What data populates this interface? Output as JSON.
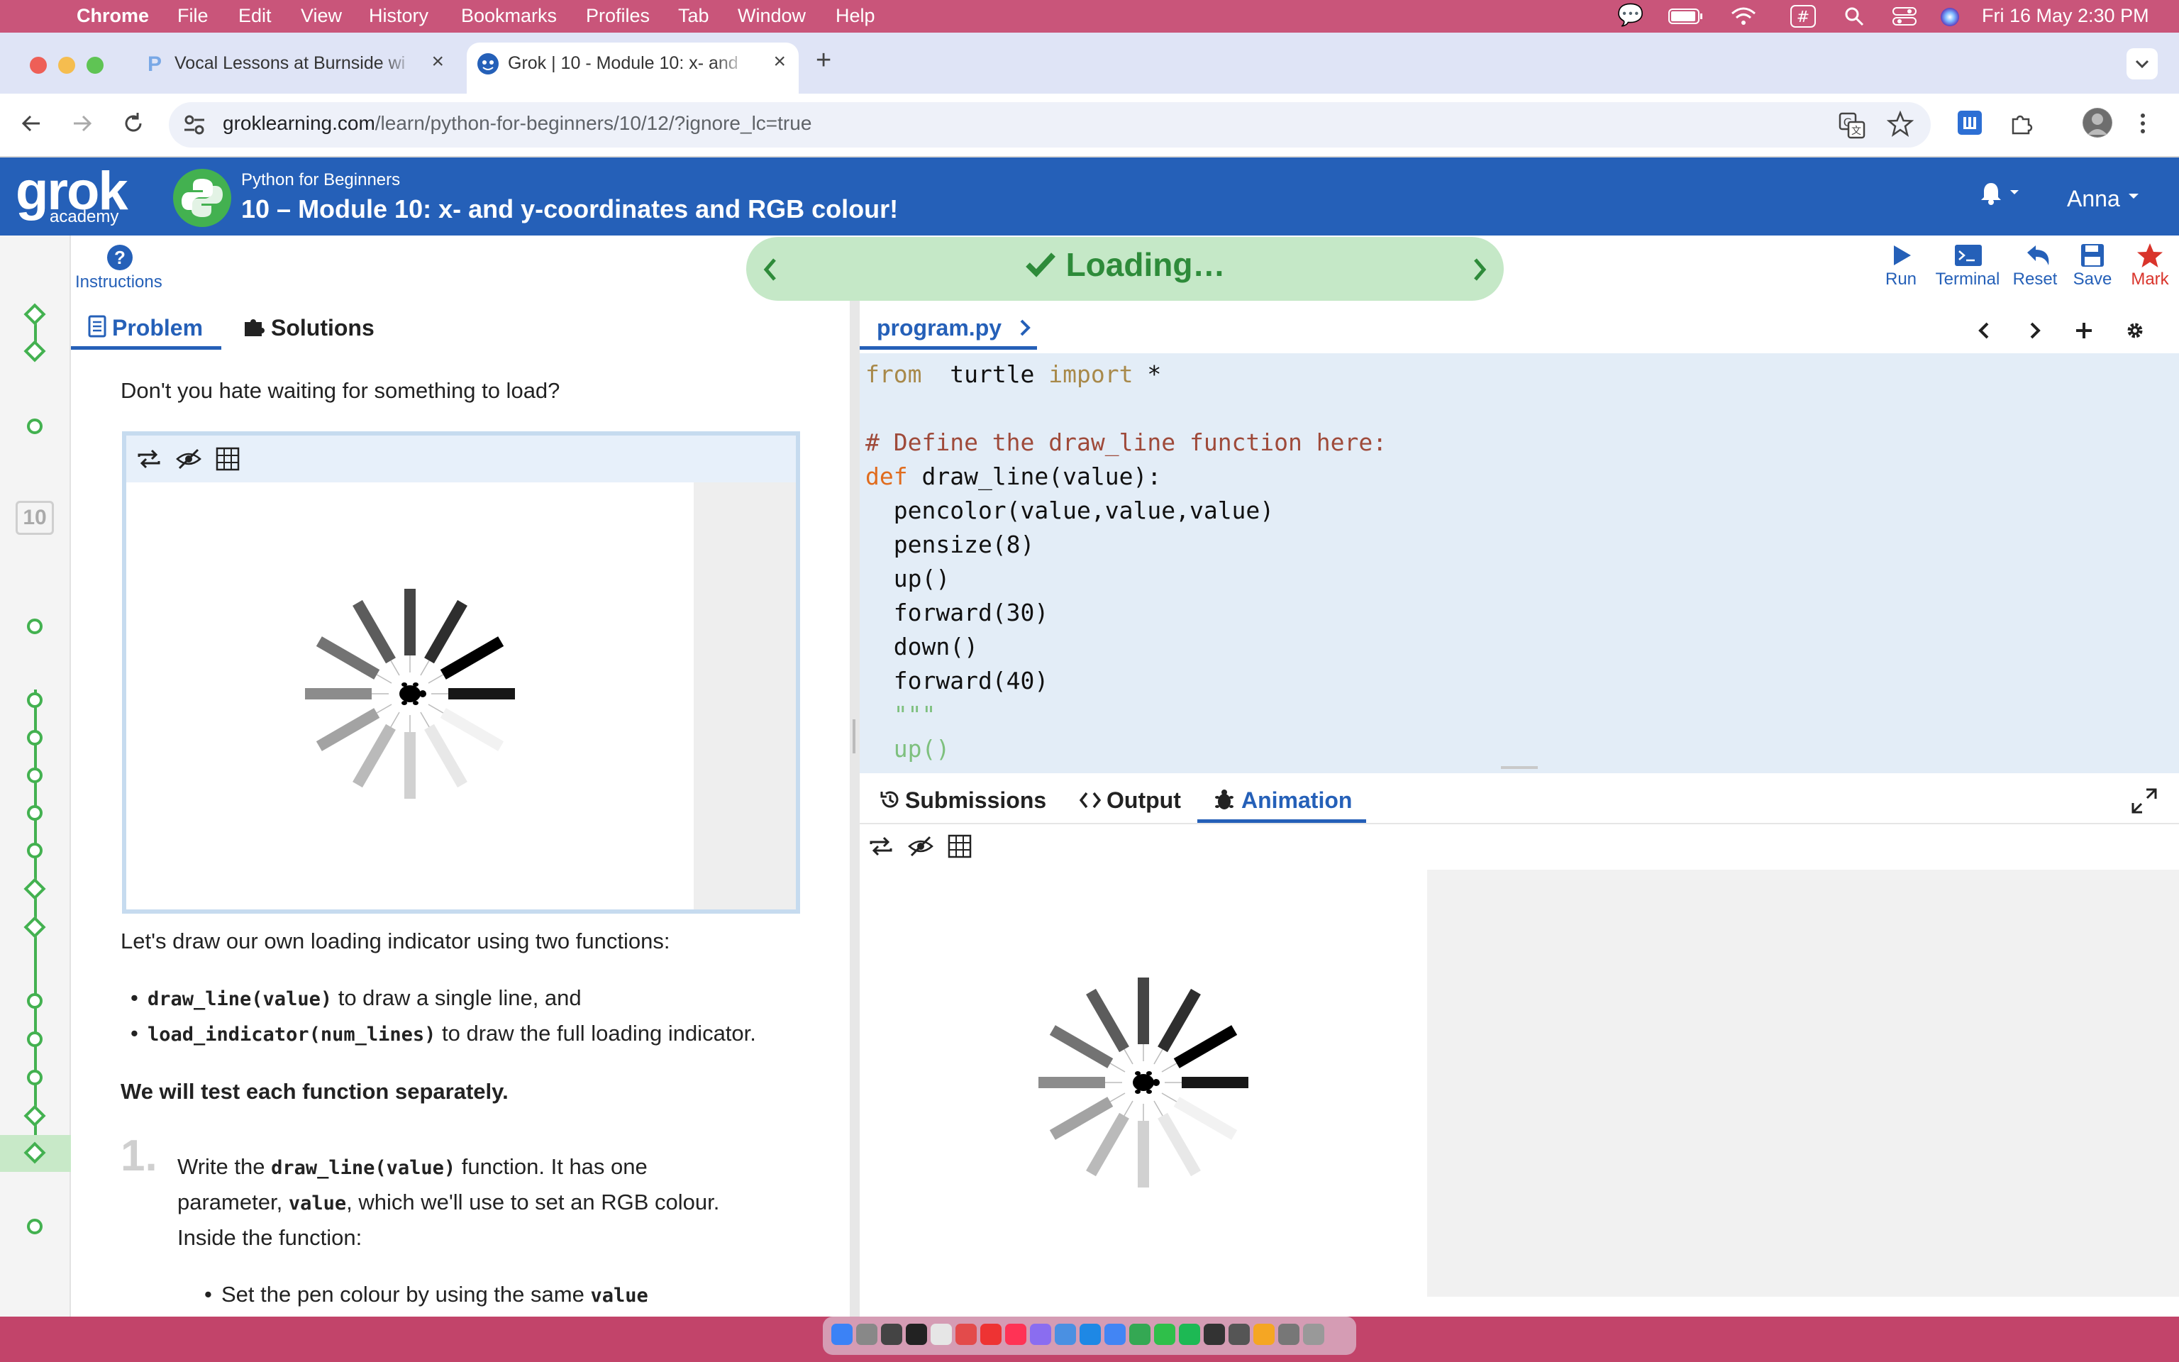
{
  "menubar": {
    "app": "Chrome",
    "items": [
      "File",
      "Edit",
      "View",
      "History",
      "Bookmarks",
      "Profiles",
      "Tab",
      "Window",
      "Help"
    ],
    "clock": "Fri 16 May  2:30 PM"
  },
  "tabs": [
    {
      "title": "Vocal Lessons at Burnside wi",
      "active": false
    },
    {
      "title": "Grok | 10 - Module 10: x- and",
      "active": true
    }
  ],
  "address": {
    "host": "groklearning.com",
    "path": "/learn/python-for-beginners/10/12/?ignore_lc=true"
  },
  "grok": {
    "logo": "grok",
    "logo_sub": "academy",
    "course": "Python for Beginners",
    "module_title": "10 – Module 10: x- and y-coordinates and RGB colour!",
    "user": "Anna"
  },
  "nav": {
    "instructions": "Instructions",
    "banner": "Loading…",
    "tools": [
      "Run",
      "Terminal",
      "Reset",
      "Save",
      "Mark"
    ]
  },
  "rail": {
    "module_number": "10"
  },
  "problem": {
    "tabs": [
      "Problem",
      "Solutions"
    ],
    "intro": "Don't you hate waiting for something to load?",
    "lead": "Let's draw our own loading indicator using two functions:",
    "bullets": [
      {
        "code": "draw_line(value)",
        "text": " to draw a single line, and"
      },
      {
        "code": "load_indicator(num_lines)",
        "text": " to draw the full loading indicator."
      }
    ],
    "bold_note": "We will test each function separately.",
    "step_number": "1.",
    "step_pre": "Write the ",
    "step_code": "draw_line(value)",
    "step_post": " function. It has one",
    "step_line2_pre": "parameter, ",
    "step_line2_code": "value",
    "step_line2_post": ", which we'll use to set an RGB colour.",
    "step_line3": "Inside the function:",
    "sub_bullet_text": "Set the pen colour by using the same ",
    "sub_bullet_code": "value"
  },
  "editor": {
    "file": "program.py",
    "lines": [
      {
        "parts": [
          [
            "imp",
            "from"
          ],
          [
            "",
            "  turtle "
          ],
          [
            "imp",
            "import"
          ],
          [
            "",
            " *"
          ]
        ]
      },
      {
        "parts": []
      },
      {
        "parts": [
          [
            "cm",
            "# Define the draw_line function here:"
          ]
        ]
      },
      {
        "parts": [
          [
            "kw",
            "def"
          ],
          [
            "",
            " draw_line(value):"
          ]
        ]
      },
      {
        "parts": [
          [
            "",
            "  pencolor(value,value,value)"
          ]
        ]
      },
      {
        "parts": [
          [
            "",
            "  pensize(8)"
          ]
        ]
      },
      {
        "parts": [
          [
            "",
            "  up()"
          ]
        ]
      },
      {
        "parts": [
          [
            "",
            "  forward(30)"
          ]
        ]
      },
      {
        "parts": [
          [
            "",
            "  down()"
          ]
        ]
      },
      {
        "parts": [
          [
            "",
            "  forward(40)"
          ]
        ]
      },
      {
        "parts": [
          [
            "str",
            "  \"\"\""
          ]
        ]
      },
      {
        "parts": [
          [
            "str",
            "  up()"
          ]
        ]
      }
    ]
  },
  "bottom_tabs": [
    "Submissions",
    "Output",
    "Animation"
  ],
  "spinner": {
    "gray_levels": [
      0.09,
      0.0,
      0.18,
      0.27,
      0.36,
      0.45,
      0.55,
      0.64,
      0.73,
      0.82,
      0.91,
      0.95
    ]
  },
  "colors": {
    "grok_blue": "#2560b8",
    "progress_green": "#43b150",
    "banner_bg": "#c5e8c7",
    "banner_text": "#2e8b3a",
    "mark_red": "#d9342b"
  }
}
